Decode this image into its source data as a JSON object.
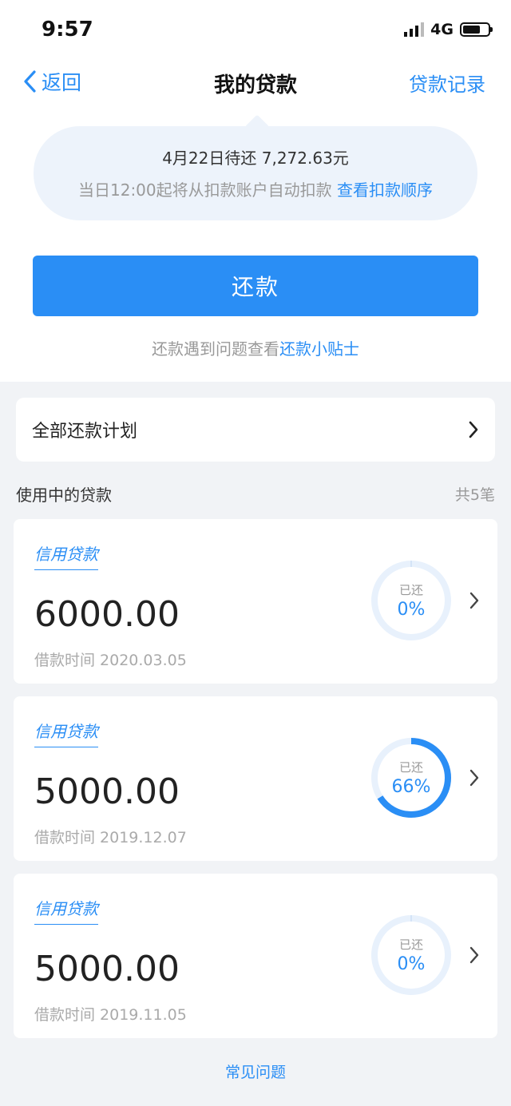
{
  "status_bar": {
    "time": "9:57",
    "network": "4G"
  },
  "nav": {
    "back_label": "返回",
    "title": "我的贷款",
    "record_label": "贷款记录"
  },
  "notice": {
    "line1": "4月22日待还 7,272.63元",
    "line2_prefix": "当日12:00起将从扣款账户自动扣款",
    "line2_link": "查看扣款顺序"
  },
  "repay_button_label": "还款",
  "tips": {
    "prefix": "还款遇到问题查看",
    "link": "还款小贴士"
  },
  "plan_label": "全部还款计划",
  "section": {
    "title": "使用中的贷款",
    "count": "共5笔"
  },
  "loans": [
    {
      "type": "信用贷款",
      "amount": "6000.00",
      "date": "借款时间 2020.03.05",
      "repaid_label": "已还",
      "repaid_pct_text": "0%",
      "repaid_fraction": 0.0
    },
    {
      "type": "信用贷款",
      "amount": "5000.00",
      "date": "借款时间 2019.12.07",
      "repaid_label": "已还",
      "repaid_pct_text": "66%",
      "repaid_fraction": 0.66
    },
    {
      "type": "信用贷款",
      "amount": "5000.00",
      "date": "借款时间 2019.11.05",
      "repaid_label": "已还",
      "repaid_pct_text": "0%",
      "repaid_fraction": 0.0
    }
  ],
  "faq_label": "常见问题",
  "colors": {
    "accent": "#2a8ef5",
    "ring_track": "#e8f1fc",
    "background": "#f1f3f6"
  },
  "icons": {
    "back": "chevron-left-icon",
    "forward": "chevron-right-icon"
  }
}
